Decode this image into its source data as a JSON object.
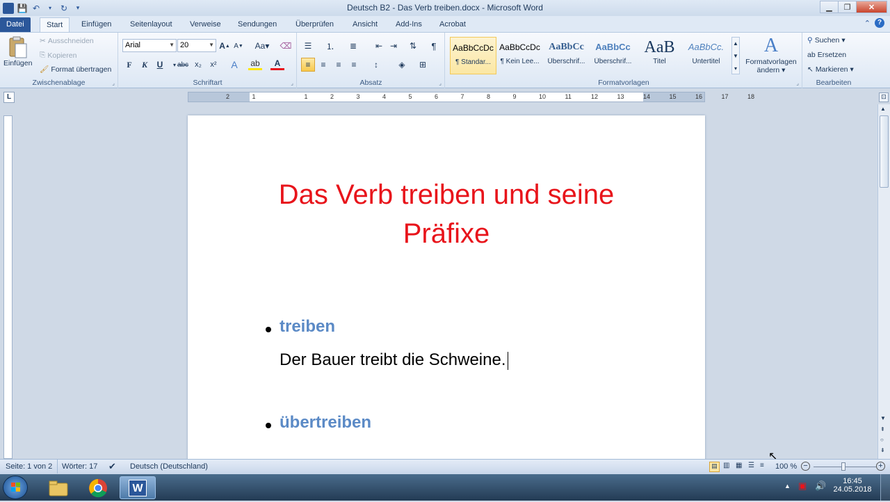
{
  "window": {
    "title": "Deutsch B2 - Das Verb treiben.docx - Microsoft Word"
  },
  "tabs": [
    "Datei",
    "Start",
    "Einfügen",
    "Seitenlayout",
    "Verweise",
    "Sendungen",
    "Überprüfen",
    "Ansicht",
    "Add-Ins",
    "Acrobat"
  ],
  "clipboard": {
    "paste": "Einfügen",
    "cut": "Ausschneiden",
    "copy": "Kopieren",
    "format_painter": "Format übertragen",
    "label": "Zwischenablage"
  },
  "font": {
    "name": "Arial",
    "size": "20",
    "label": "Schriftart",
    "bold": "F",
    "italic": "K",
    "underline": "U"
  },
  "paragraph": {
    "label": "Absatz"
  },
  "styles": {
    "label": "Formatvorlagen",
    "items": [
      {
        "preview": "AaBbCcDc",
        "name": "¶ Standar..."
      },
      {
        "preview": "AaBbCcDc",
        "name": "¶ Kein Lee..."
      },
      {
        "preview": "AaBbCc",
        "name": "Überschrif..."
      },
      {
        "preview": "AaBbCc",
        "name": "Überschrif..."
      },
      {
        "preview": "AaB",
        "name": "Titel"
      },
      {
        "preview": "AaBbCc.",
        "name": "Untertitel"
      }
    ],
    "change_line1": "Formatvorlagen",
    "change_line2": "ändern"
  },
  "editing": {
    "find": "Suchen",
    "replace": "Ersetzen",
    "select": "Markieren",
    "label": "Bearbeiten"
  },
  "document": {
    "title_line1": "Das Verb treiben und seine",
    "title_line2": "Präfixe",
    "bullet1": "treiben",
    "sentence1": "Der Bauer treibt die Schweine.",
    "bullet2": "übertreiben"
  },
  "ruler_numbers": [
    "2",
    "1",
    "1",
    "2",
    "3",
    "4",
    "5",
    "6",
    "7",
    "8",
    "9",
    "10",
    "11",
    "12",
    "13",
    "14",
    "15",
    "16",
    "17",
    "18"
  ],
  "status": {
    "page": "Seite: 1 von 2",
    "words": "Wörter: 17",
    "language": "Deutsch (Deutschland)",
    "zoom": "100 %"
  },
  "clock": {
    "time": "16:45",
    "date": "24.05.2018"
  }
}
